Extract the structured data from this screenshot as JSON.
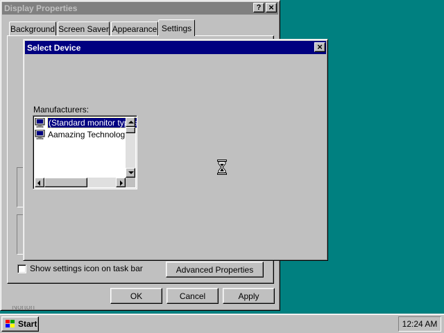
{
  "display_properties": {
    "title": "Display Properties",
    "help_label": "?",
    "close_label": "×",
    "tabs": [
      {
        "label": "Background"
      },
      {
        "label": "Screen Saver"
      },
      {
        "label": "Appearance"
      },
      {
        "label": "Settings"
      }
    ],
    "show_icon_checkbox": {
      "label": "Show settings icon on task bar",
      "checked": false
    },
    "advanced_label": "Advanced Properties",
    "ok_label": "OK",
    "cancel_label": "Cancel",
    "apply_label": "Apply",
    "behind_text": "Norton"
  },
  "select_device": {
    "title": "Select Device",
    "close_label": "×",
    "manufacturers_label": "Manufacturers:",
    "manufacturers": [
      {
        "label": "(Standard monitor types)",
        "selected": true,
        "icon": "monitor-icon"
      },
      {
        "label": "Aamazing Technologies",
        "selected": false,
        "icon": "monitor-icon"
      }
    ]
  },
  "taskbar": {
    "start_label": "Start",
    "clock": "12:24 AM"
  },
  "cursor": {
    "icon": "hourglass-icon"
  },
  "colors": {
    "desktop": "#008080",
    "title_active": "#000080",
    "title_inactive": "#808080",
    "face": "#c0c0c0"
  }
}
